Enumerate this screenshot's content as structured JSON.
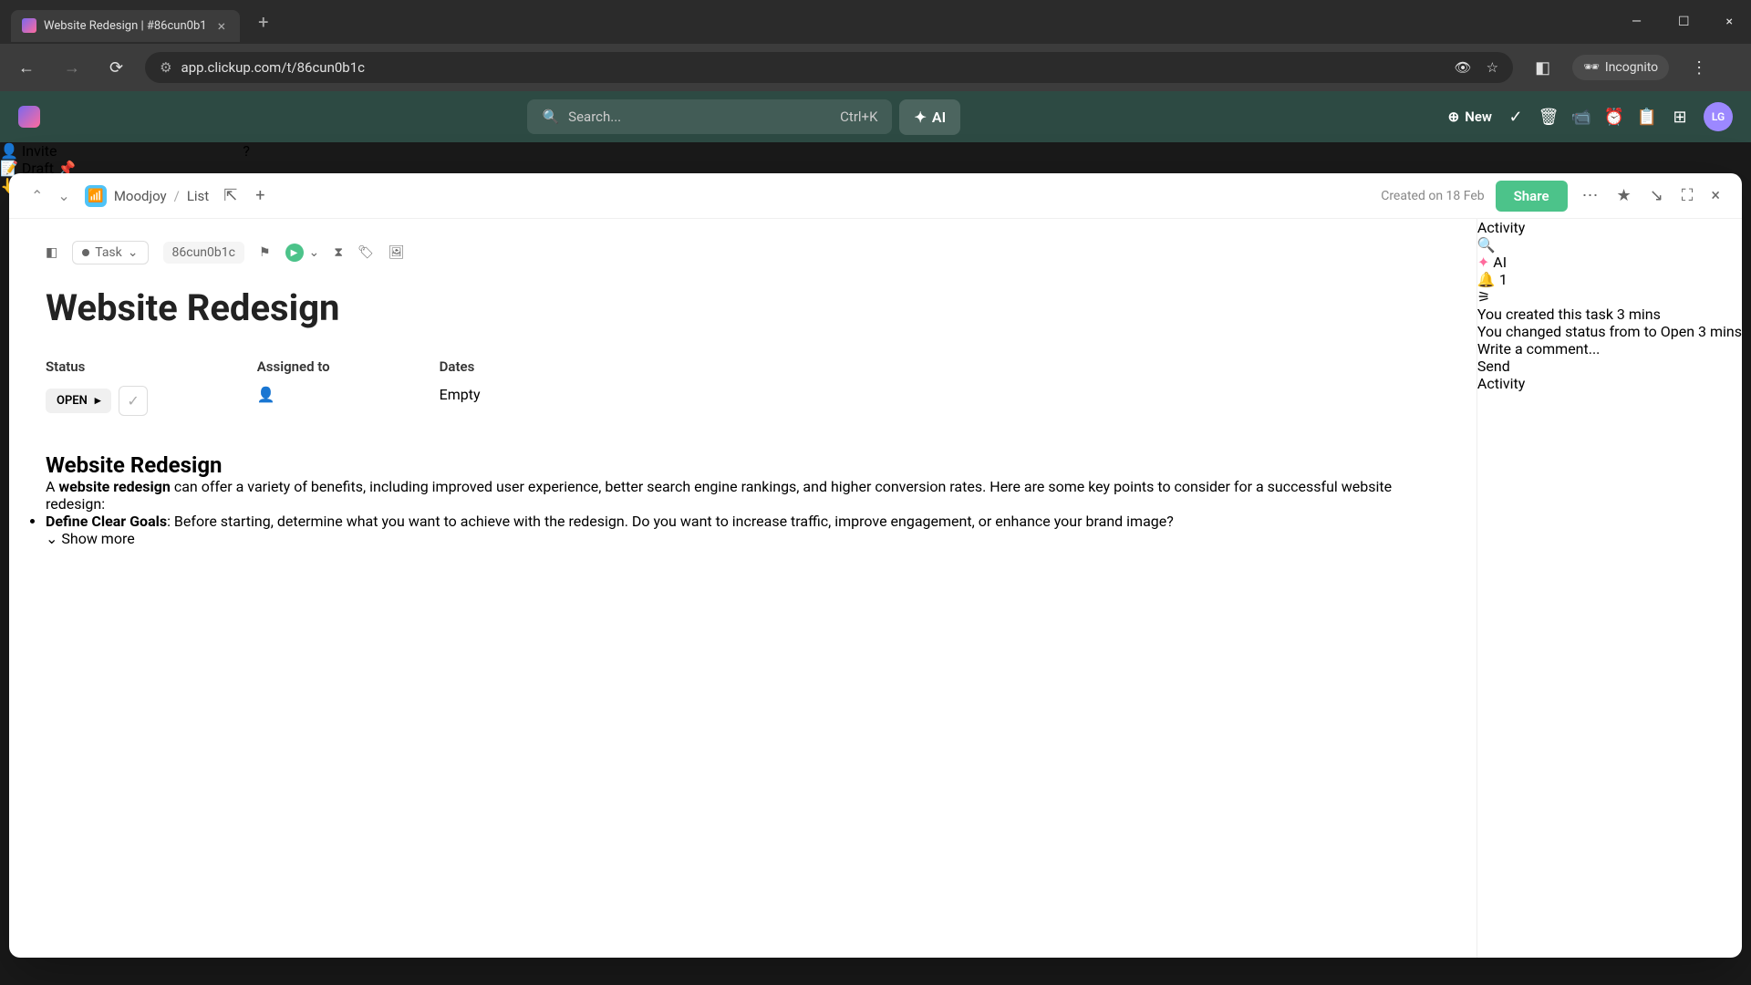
{
  "browser": {
    "tab_title": "Website Redesign | #86cun0b1",
    "url": "app.clickup.com/t/86cun0b1c",
    "incognito_label": "Incognito"
  },
  "app_header": {
    "search_placeholder": "Search...",
    "search_shortcut": "Ctrl+K",
    "ai_label": "AI",
    "new_label": "New",
    "avatar_initials": "LG"
  },
  "modal": {
    "breadcrumb": {
      "workspace": "Moodjoy",
      "list": "List"
    },
    "created_label": "Created on 18 Feb",
    "share_label": "Share",
    "toolbar": {
      "type_label": "Task",
      "task_id": "86cun0b1c"
    },
    "title": "Website Redesign",
    "fields": {
      "status_label": "Status",
      "status_value": "OPEN",
      "assigned_label": "Assigned to",
      "dates_label": "Dates",
      "dates_value": "Empty"
    },
    "description": {
      "heading": "Website Redesign",
      "intro_prefix": "A ",
      "intro_bold": "website redesign",
      "intro_rest": " can offer a variety of benefits, including improved user experience, better search engine rankings, and higher conversion rates. Here are some key points to consider for a successful website redesign:",
      "bullet1_bold": "Define Clear Goals",
      "bullet1_rest": ": Before starting, determine what you want to achieve with the redesign. Do you want to increase traffic, improve engagement, or enhance your brand image?",
      "show_more": "Show more"
    }
  },
  "activity": {
    "title": "Activity",
    "ai_label": "AI",
    "bell_count": "1",
    "items": [
      {
        "actor": "You",
        "text": "created this task",
        "time": "3 mins"
      },
      {
        "actor": "You",
        "prefix": "changed status from",
        "from_color": "#2d3436",
        "to_word": "to",
        "to_color": "#b2bec3",
        "to_label": "Open",
        "time": "3 mins"
      }
    ],
    "comment_placeholder": "Write a comment...",
    "send_label": "Send",
    "side_tab_label": "Activity"
  },
  "bottom": {
    "invite_label": "Invite",
    "draft_label": "Draft"
  }
}
